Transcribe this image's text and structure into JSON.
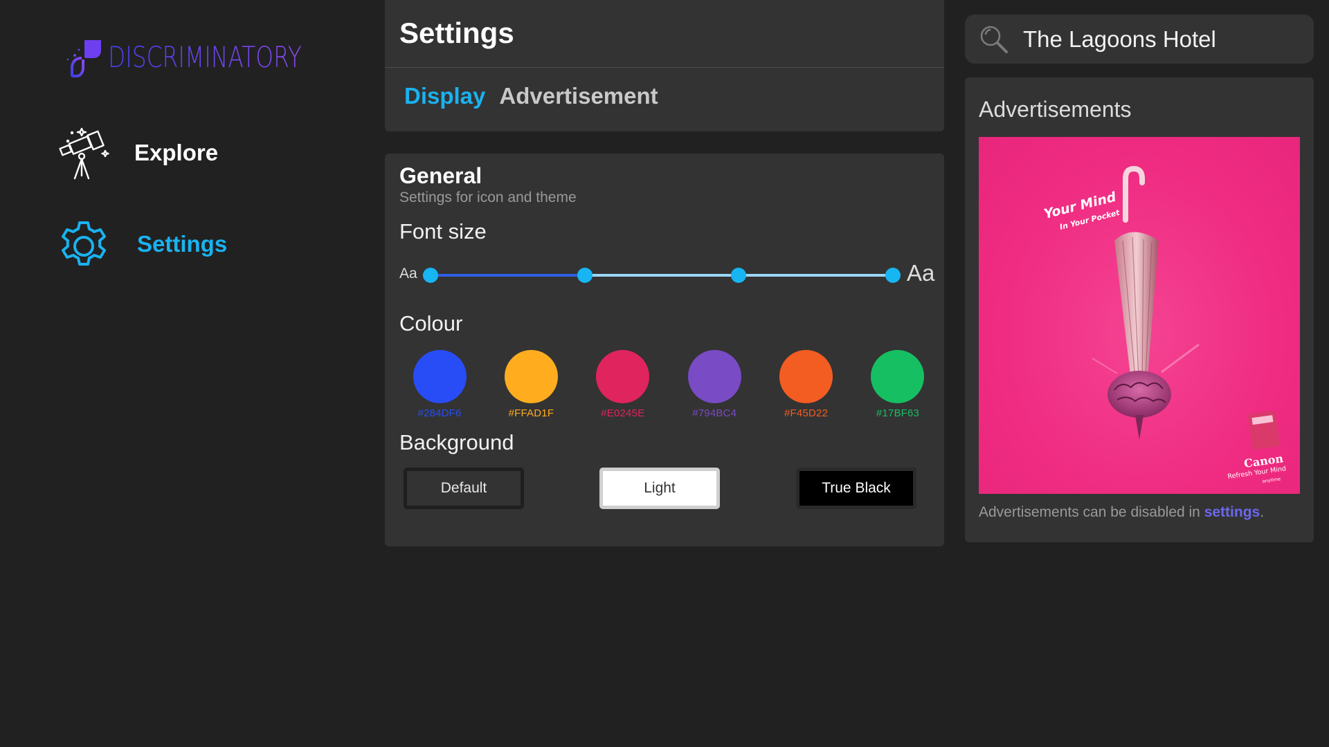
{
  "brand": {
    "name": "DISCRIMINATORY"
  },
  "nav": {
    "items": [
      {
        "label": "Explore",
        "icon": "telescope-icon",
        "active": false
      },
      {
        "label": "Settings",
        "icon": "gear-icon",
        "active": true
      }
    ]
  },
  "header": {
    "title": "Settings",
    "tabs": [
      {
        "label": "Display",
        "active": true
      },
      {
        "label": "Advertisement",
        "active": false
      }
    ]
  },
  "general": {
    "title": "General",
    "subtitle": "Settings for icon and theme",
    "font_size": {
      "label": "Font size",
      "small_label": "Aa",
      "large_label": "Aa",
      "stops": 4,
      "selected_stop": 2
    },
    "colour": {
      "label": "Colour",
      "swatches": [
        {
          "hex": "#284DF6"
        },
        {
          "hex": "#FFAD1F"
        },
        {
          "hex": "#E0245E"
        },
        {
          "hex": "#794BC4"
        },
        {
          "hex": "#F45D22"
        },
        {
          "hex": "#17BF63"
        }
      ]
    },
    "background": {
      "label": "Background",
      "options": [
        {
          "label": "Default"
        },
        {
          "label": "Light"
        },
        {
          "label": "True Black"
        }
      ]
    }
  },
  "search": {
    "value": "The Lagoons Hotel"
  },
  "ads": {
    "title": "Advertisements",
    "image": {
      "headline_line1": "Your Mind",
      "headline_line2": "In Your Pocket",
      "brand": "Canon",
      "tagline": "Refresh Your Mind",
      "tagline2": "anytime"
    },
    "note_prefix": "Advertisements can be disabled in ",
    "note_link": "settings",
    "note_suffix": "."
  },
  "colors": {
    "accent": "#1AB2F0",
    "background": "#212121",
    "panel": "#333333",
    "link": "#6B68EE",
    "ad_background": "#EF2C82"
  }
}
